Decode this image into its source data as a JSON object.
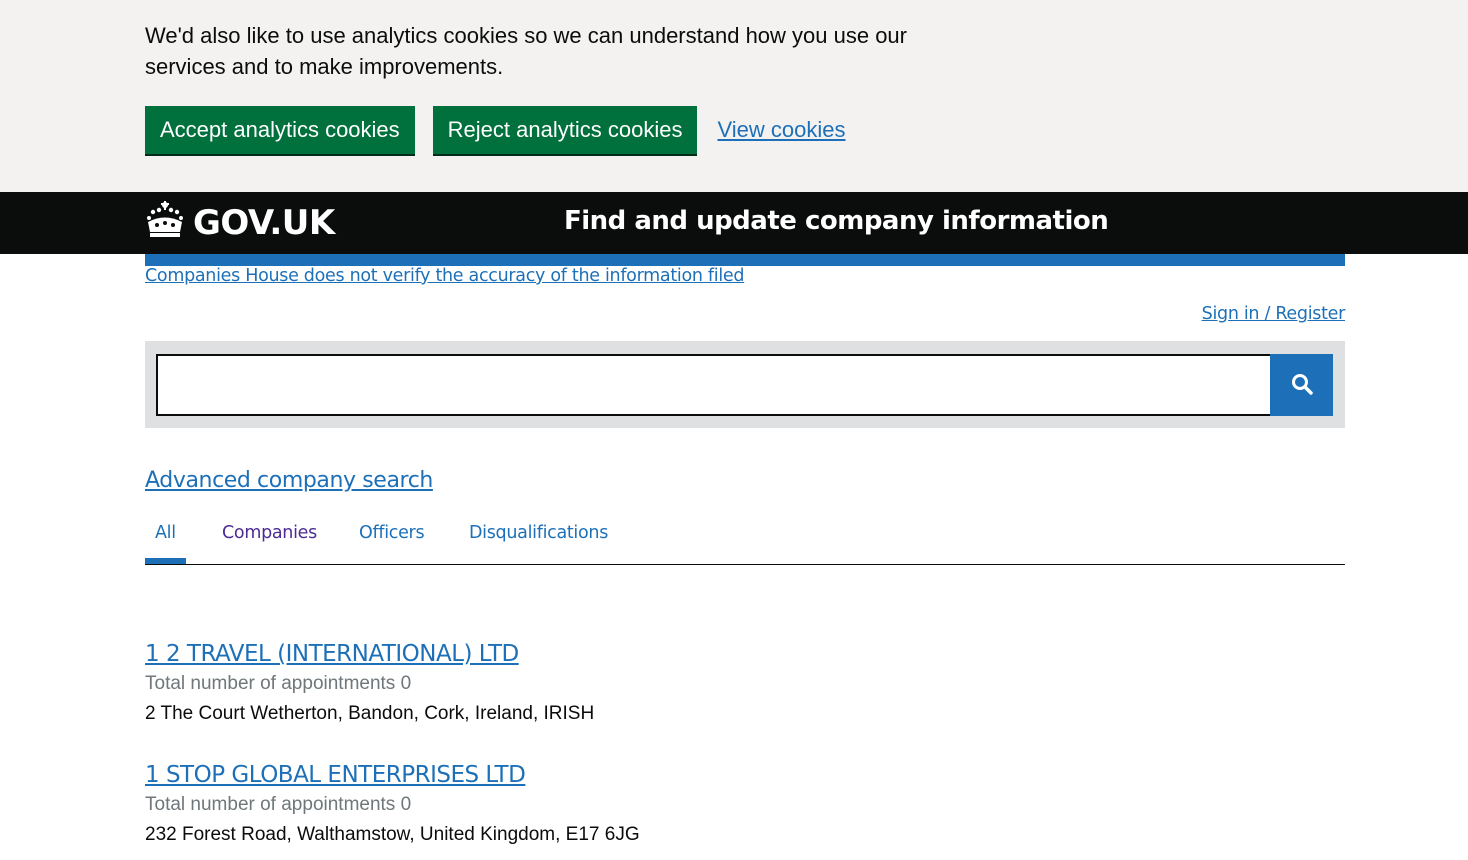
{
  "cookie_banner": {
    "message": "We'd also like to use analytics cookies so we can understand how you use our services and to make improvements.",
    "accept_label": "Accept analytics cookies",
    "reject_label": "Reject analytics cookies",
    "view_label": "View cookies"
  },
  "header": {
    "logo_text": "GOV.UK",
    "service_name": "Find and update company information"
  },
  "notice": {
    "accuracy_link": "Companies House does not verify the accuracy of the information filed"
  },
  "account": {
    "signin_label": "Sign in / Register"
  },
  "search": {
    "value": "",
    "placeholder": "",
    "button_icon": "search-icon"
  },
  "advanced_search_label": "Advanced company search",
  "tabs": [
    {
      "label": "All",
      "selected": true
    },
    {
      "label": "Companies",
      "selected": false
    },
    {
      "label": "Officers",
      "selected": false
    },
    {
      "label": "Disqualifications",
      "selected": false
    }
  ],
  "results": [
    {
      "title": "1 2 TRAVEL (INTERNATIONAL) LTD",
      "appointments": "Total number of appointments 0",
      "address": "2 The Court Wetherton, Bandon, Cork, Ireland, IRISH"
    },
    {
      "title": "1 STOP GLOBAL ENTERPRISES LTD",
      "appointments": "Total number of appointments 0",
      "address": "232 Forest Road, Walthamstow, United Kingdom, E17 6JG"
    }
  ],
  "colors": {
    "green_button": "#00703c",
    "link_blue": "#1d70b8",
    "visited_purple": "#4c2c92",
    "header_black": "#0b0c0c",
    "banner_grey": "#f3f2f1"
  }
}
